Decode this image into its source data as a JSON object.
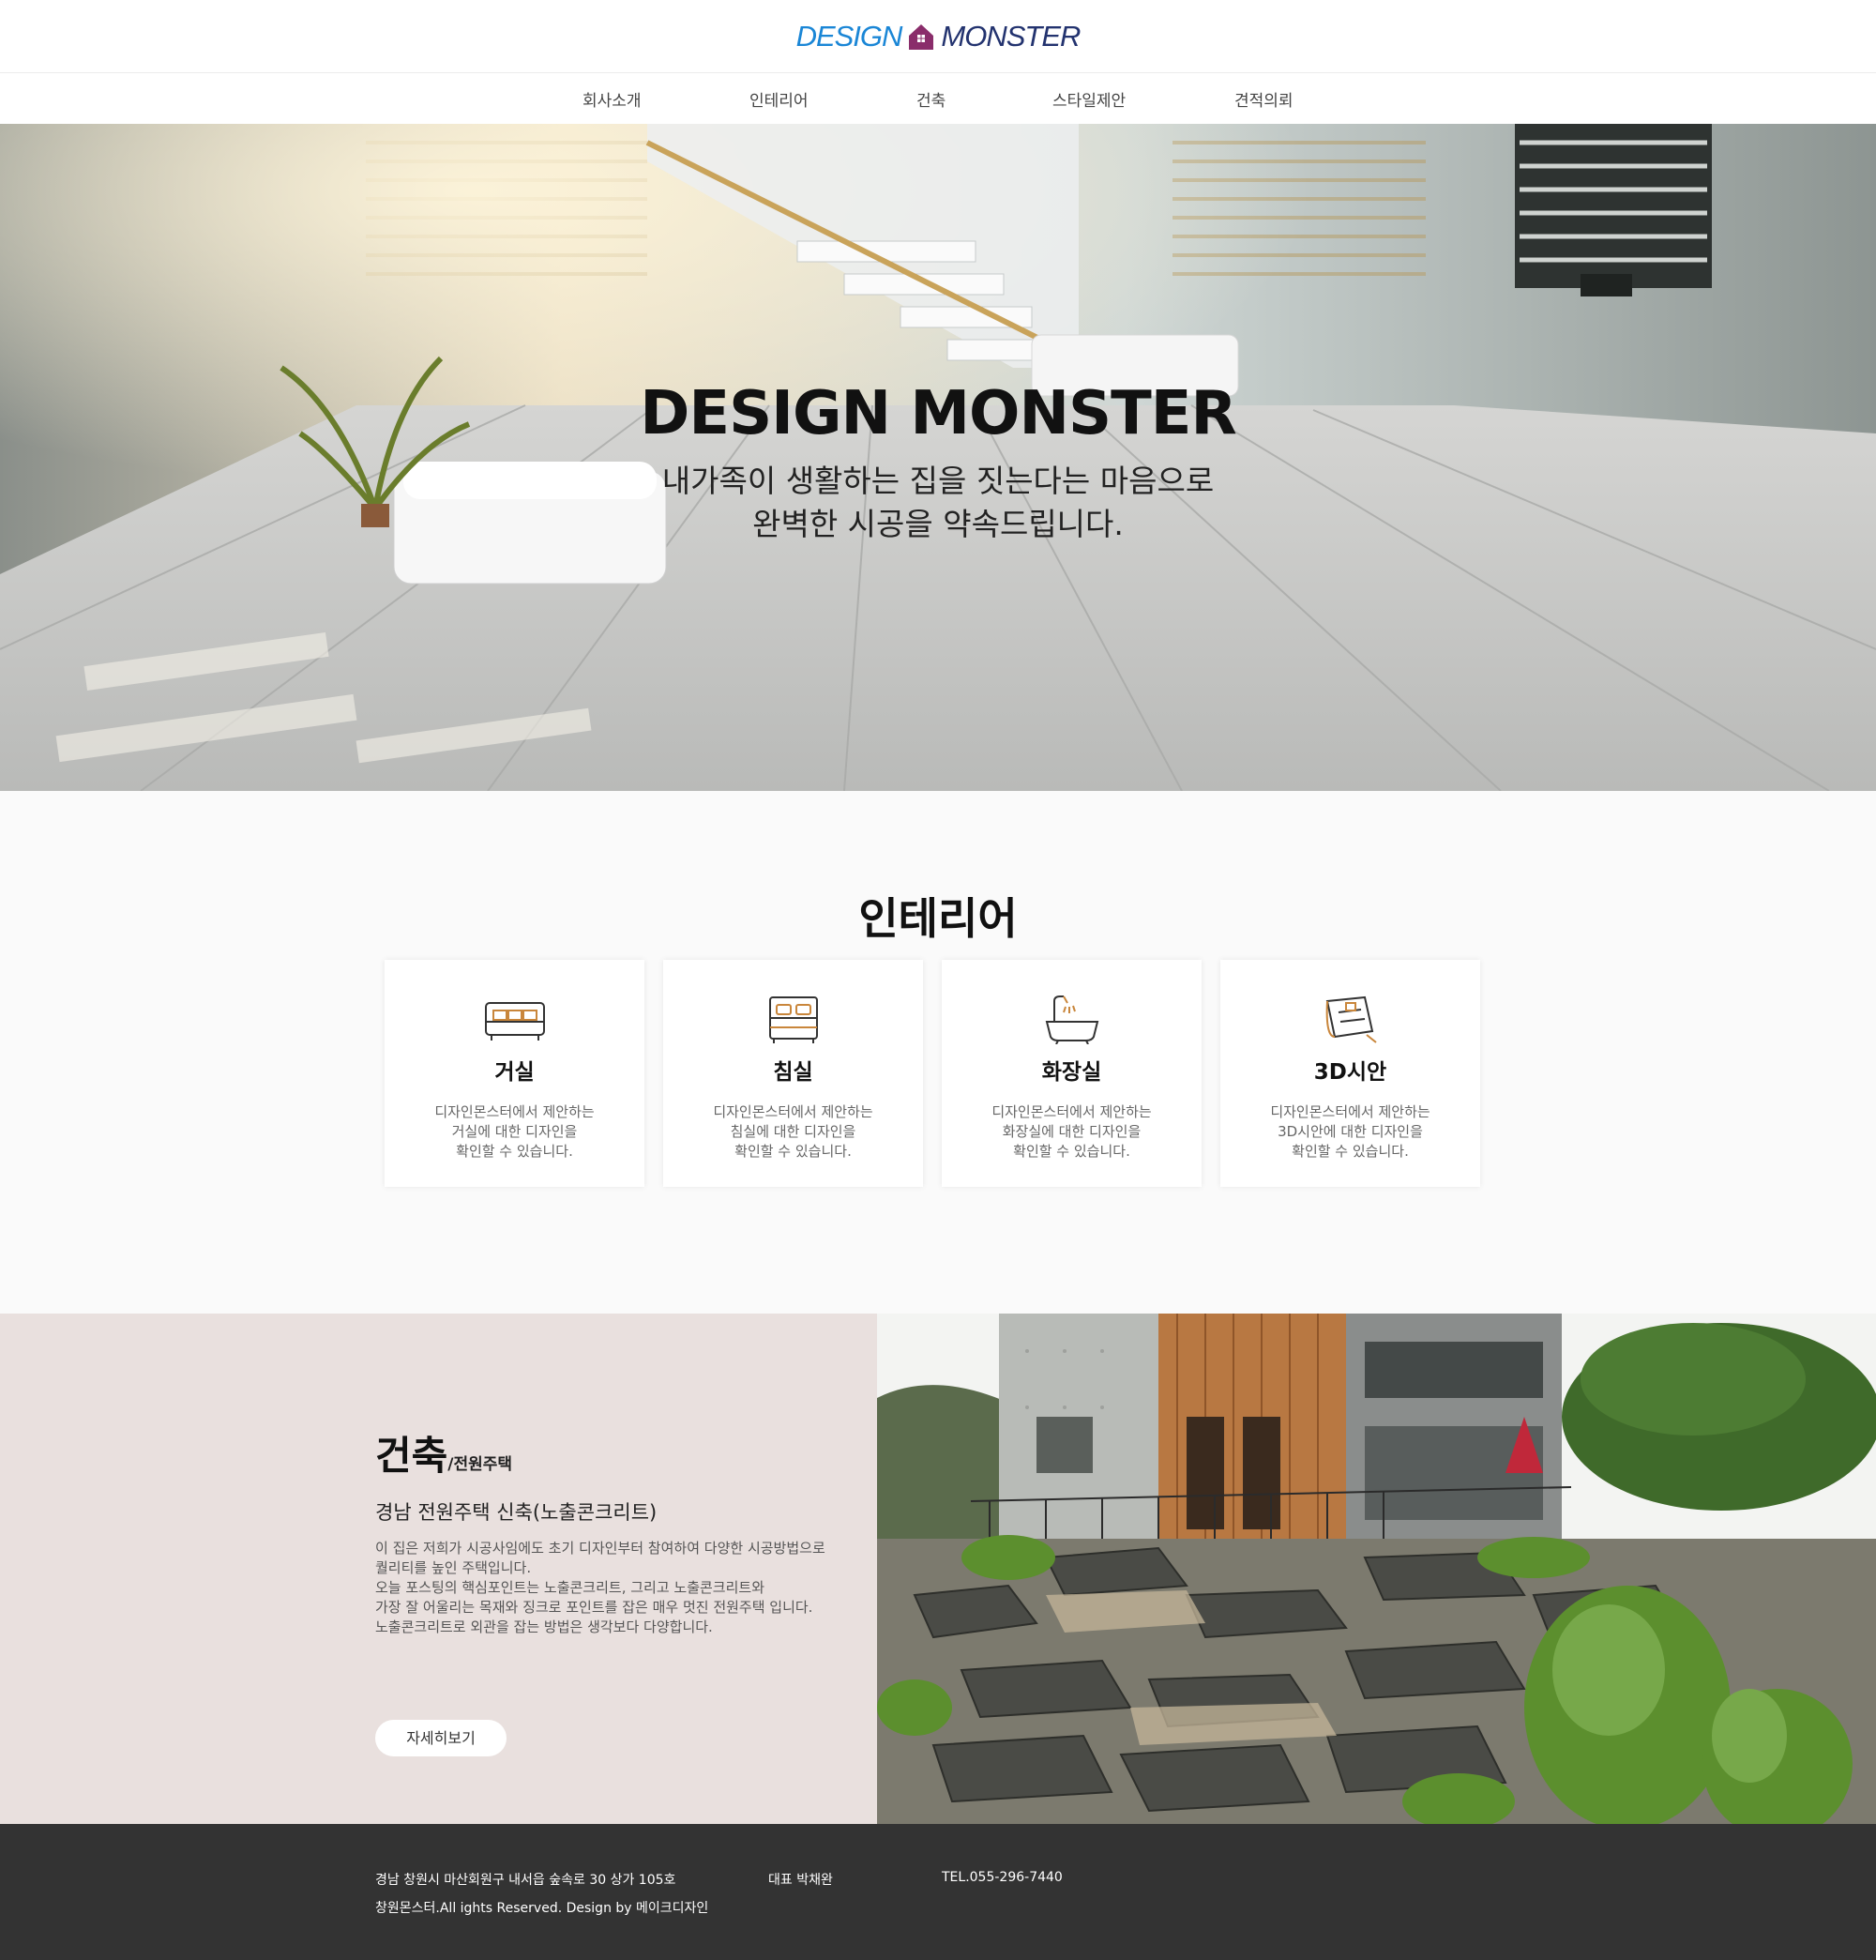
{
  "brand": {
    "logo_left": "DESIGN",
    "logo_right": "MONSTER"
  },
  "nav": [
    "회사소개",
    "인테리어",
    "건축",
    "스타일제안",
    "견적의뢰"
  ],
  "hero": {
    "title": "DESIGN MONSTER",
    "line1": "내가족이 생활하는 집을 짓는다는 마음으로",
    "line2": "완벽한 시공을 약속드립니다."
  },
  "interior": {
    "title": "인테리어",
    "cards": [
      {
        "icon": "sofa-icon",
        "title": "거실",
        "desc": [
          "디자인몬스터에서 제안하는",
          "거실에 대한 디자인을",
          "확인할 수 있습니다."
        ]
      },
      {
        "icon": "bed-icon",
        "title": "침실",
        "desc": [
          "디자인몬스터에서 제안하는",
          "침실에 대한 디자인을",
          "확인할 수 있습니다."
        ]
      },
      {
        "icon": "bathtub-icon",
        "title": "화장실",
        "desc": [
          "디자인몬스터에서 제안하는",
          "화장실에 대한 디자인을",
          "확인할 수 있습니다."
        ]
      },
      {
        "icon": "blueprint-icon",
        "title": "3D시안",
        "desc": [
          "디자인몬스터에서 제안하는",
          "3D시안에 대한 디자인을",
          "확인할 수 있습니다."
        ]
      }
    ]
  },
  "architecture": {
    "heading": "건축",
    "heading_sub": "/전원주택",
    "subtitle": "경남 전원주택 신축(노출콘크리트)",
    "desc": [
      "이 집은 저희가 시공사임에도 초기 디자인부터 참여하여 다양한 시공방법으로",
      "퀄리티를 높인 주택입니다.",
      "오늘 포스팅의 핵심포인트는 노출콘크리트, 그리고 노출콘크리트와",
      "가장 잘 어울리는 목재와 징크로 포인트를 잡은 매우 멋진 전원주택 입니다.",
      "노출콘크리트로 외관을 잡는 방법은 생각보다 다양합니다."
    ],
    "button": "자세히보기"
  },
  "footer": {
    "address": "경남 창원시 마산회원구 내서읍 숲속로 30 상가 105호",
    "ceo": "대표 박채완",
    "tel": "TEL.055-296-7440",
    "copyright": "창원몬스터.All ights Reserved. Design by 메이크디자인"
  },
  "colors": {
    "logo_blue": "#1a86d6",
    "logo_navy": "#23336f",
    "logo_house": "#8a2d6b",
    "arch_bg": "#e9e0de",
    "footer_bg": "#333333",
    "icon_accent": "#c9863b"
  }
}
